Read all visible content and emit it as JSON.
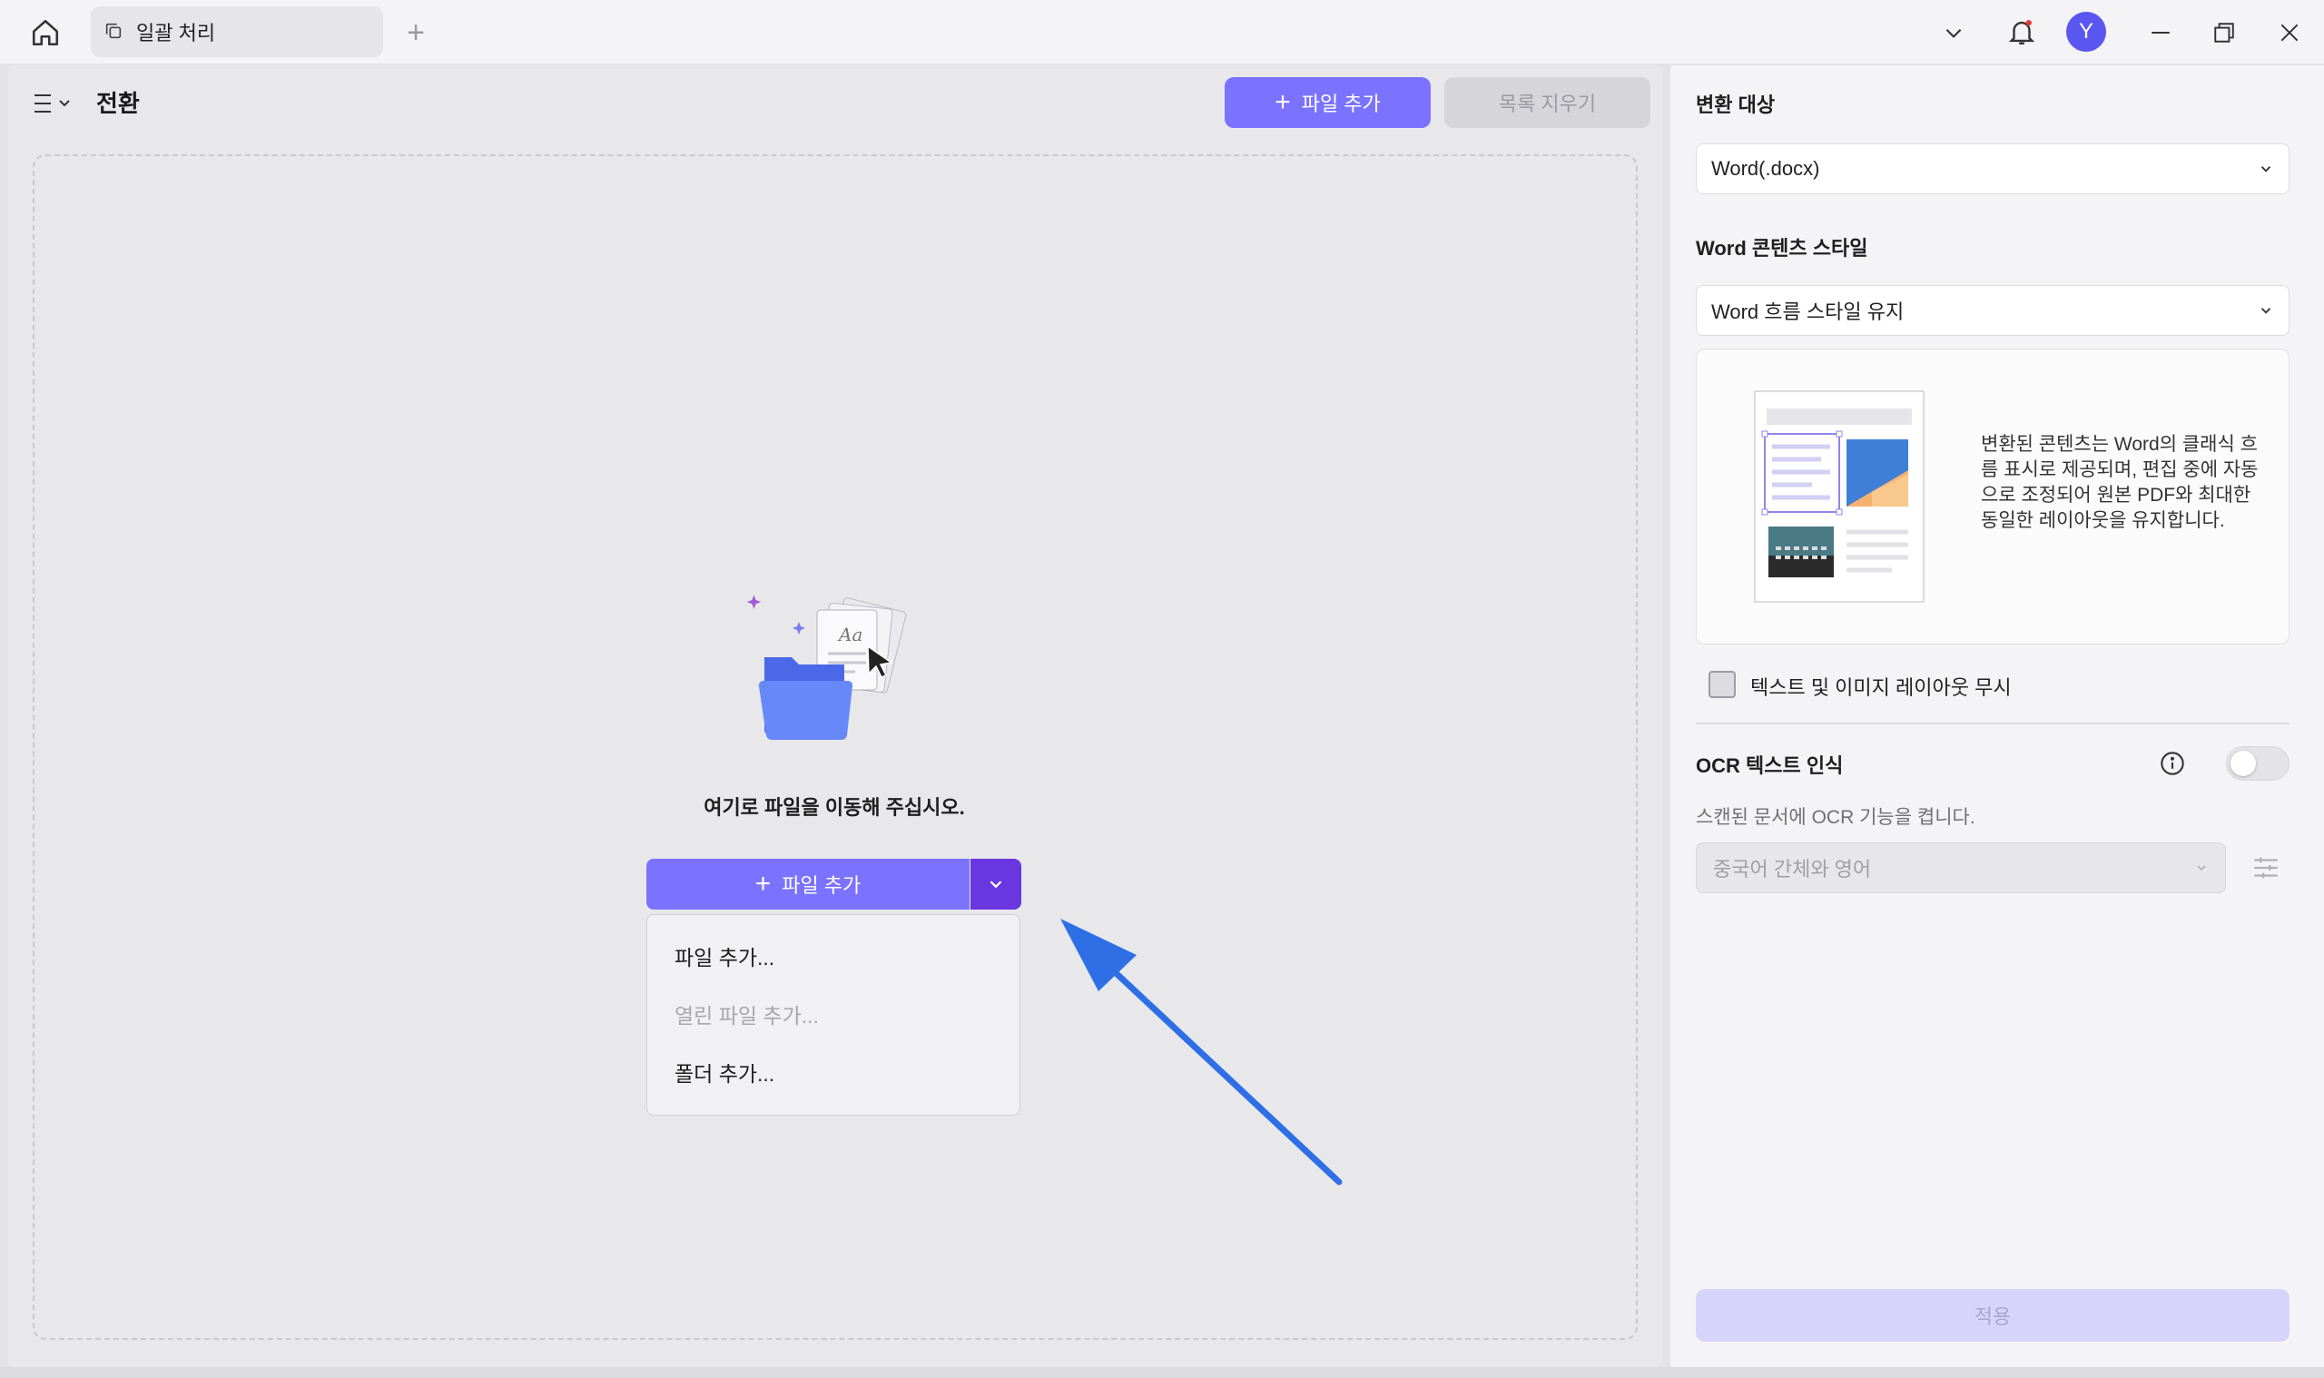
{
  "titlebar": {
    "tab_label": "일괄 처리",
    "avatar_initial": "Y"
  },
  "left": {
    "title": "전환",
    "add_file_label": "파일 추가",
    "clear_list_label": "목록 지우기",
    "drop_hint": "여기로 파일을 이동해 주십시오.",
    "add_file_main_label": "파일 추가",
    "dropdown_items": [
      {
        "label": "파일 추가...",
        "enabled": true
      },
      {
        "label": "열린 파일 추가...",
        "enabled": false
      },
      {
        "label": "폴더 추가...",
        "enabled": true
      }
    ]
  },
  "right": {
    "target_label": "변환 대상",
    "target_value": "Word(.docx)",
    "style_label": "Word 콘텐츠 스타일",
    "style_value": "Word 흐름 스타일 유지",
    "preview_text": "변환된 콘텐츠는 Word의 클래식 흐름 표시로 제공되며, 편집 중에 자동으로 조정되어 원본 PDF와 최대한 동일한 레이아웃을 유지합니다.",
    "ignore_layout_label": "텍스트 및 이미지 레이아웃 무시",
    "ocr_label": "OCR 텍스트 인식",
    "ocr_desc": "스캔된 문서에 OCR 기능을 켭니다.",
    "ocr_lang": "중국어 간체와 영어",
    "apply_label": "적용"
  },
  "colors": {
    "accent": "#7b73ff",
    "accent_dark": "#6a36e0",
    "arrow": "#2f6fe6"
  }
}
